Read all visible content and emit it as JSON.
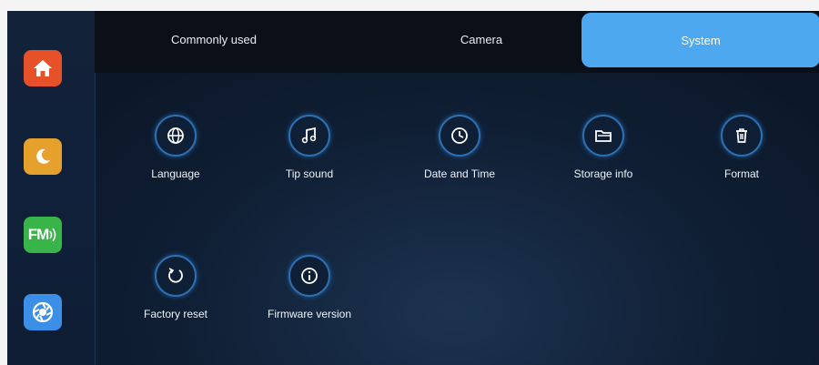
{
  "tabs": {
    "common": "Commonly used",
    "camera": "Camera",
    "system": "System"
  },
  "sidebar": {
    "home": "home-icon",
    "night": "moon-icon",
    "fm": "FM",
    "camera": "aperture-icon"
  },
  "items": {
    "language": "Language",
    "tip_sound": "Tip sound",
    "date_time": "Date and Time",
    "storage": "Storage info",
    "format": "Format",
    "factory_reset": "Factory reset",
    "firmware": "Firmware version"
  },
  "colors": {
    "accent": "#4ea8ef",
    "home": "#e7512a",
    "night": "#e6a12c",
    "fm": "#39b449",
    "camera": "#3b8fe6"
  }
}
